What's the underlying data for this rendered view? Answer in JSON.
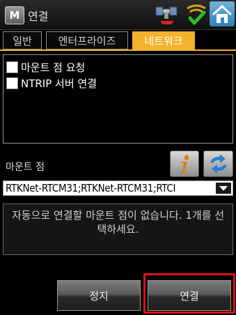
{
  "window": {
    "title": "연결",
    "app_icon_letter": "M"
  },
  "tabs": [
    {
      "label": "일반",
      "active": false
    },
    {
      "label": "엔터프라이즈",
      "active": false
    },
    {
      "label": "네트워크",
      "active": true
    }
  ],
  "options": [
    {
      "label": "마운트 점 요청",
      "checked": false
    },
    {
      "label": "NTRIP 서버 연결",
      "checked": false
    }
  ],
  "mount_point": {
    "label": "마운트 점",
    "selected": "RTKNet-RTCM31;RTKNet-RTCM31;RTCI"
  },
  "message": "자동으로 연결할 마운트 점이 없습니다. 1개를 선택하세요.",
  "buttons": {
    "stop": "정지",
    "connect": "연결"
  },
  "colors": {
    "accent": "#f2b32a",
    "highlight": "#d81414"
  },
  "icons": [
    "satellite-icon",
    "signal-check-icon",
    "home-icon",
    "info-icon",
    "refresh-icon",
    "dropdown-arrow-icon"
  ]
}
